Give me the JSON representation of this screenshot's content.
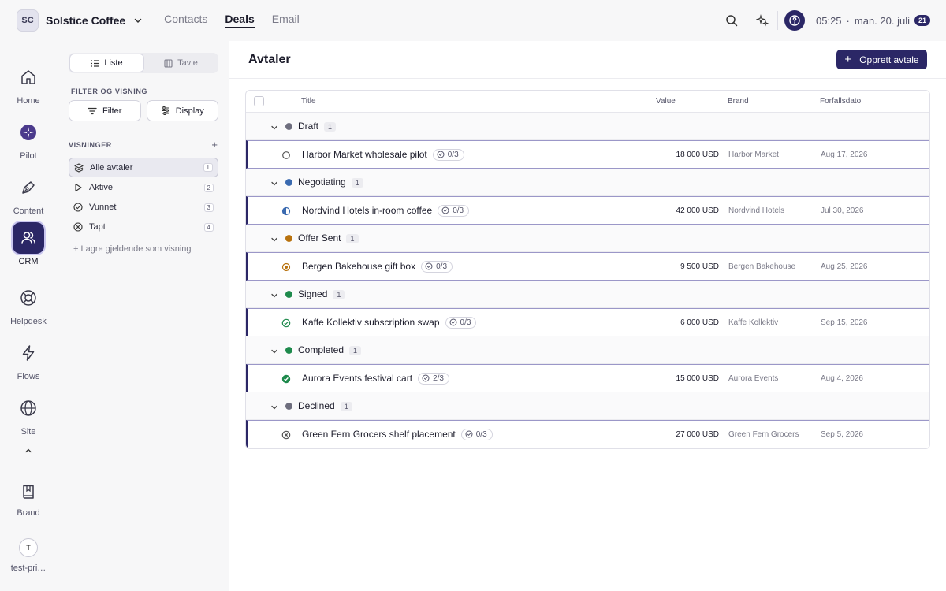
{
  "workspace": {
    "initials": "SC",
    "name": "Solstice Coffee"
  },
  "topnav": [
    {
      "label": "Contacts",
      "active": false
    },
    {
      "label": "Deals",
      "active": true
    },
    {
      "label": "Email",
      "active": false
    }
  ],
  "header": {
    "time": "05:25",
    "separator": "·",
    "date": "man. 20. juli",
    "day_badge": "21"
  },
  "rail": {
    "items": [
      {
        "label": "Home",
        "icon": "home-icon"
      },
      {
        "label": "Pilot",
        "icon": "pilot-icon"
      },
      {
        "label": "Content",
        "icon": "pen-icon"
      },
      {
        "label": "CRM",
        "icon": "users-icon",
        "active": true
      },
      {
        "label": "Helpdesk",
        "icon": "lifebuoy-icon"
      },
      {
        "label": "Flows",
        "icon": "lightning-icon"
      },
      {
        "label": "Site",
        "icon": "globe-icon"
      }
    ],
    "brand_label": "Brand",
    "user_initial": "T",
    "user_label": "test-pri…"
  },
  "sidebar": {
    "view_modes": [
      "Liste",
      "Tavle"
    ],
    "filter_section_title": "FILTER OG VISNING",
    "filter_label": "Filter",
    "display_label": "Display",
    "views_title": "VISNINGER",
    "views": [
      {
        "label": "Alle avtaler",
        "count": "1",
        "active": true
      },
      {
        "label": "Aktive",
        "count": "2"
      },
      {
        "label": "Vunnet",
        "count": "3"
      },
      {
        "label": "Tapt",
        "count": "4"
      }
    ],
    "save_view_label": "+ Lagre gjeldende som visning"
  },
  "main": {
    "title": "Avtaler",
    "create_label": "Opprett avtale",
    "columns": {
      "title": "Title",
      "value": "Value",
      "brand": "Brand",
      "due": "Forfallsdato"
    },
    "groups": [
      {
        "name": "Draft",
        "count": "1",
        "color": "#6e6e7e",
        "deal": {
          "title": "Harbor Market wholesale pilot",
          "tasks": "0/3",
          "value": "18 000 USD",
          "brand": "Harbor Market",
          "due": "Aug 17, 2026",
          "status_icon": "circle-empty-icon"
        }
      },
      {
        "name": "Negotiating",
        "count": "1",
        "color": "#3a6ab0",
        "deal": {
          "title": "Nordvind Hotels in-room coffee",
          "tasks": "0/3",
          "value": "42 000 USD",
          "brand": "Nordvind Hotels",
          "due": "Jul 30, 2026",
          "status_icon": "half-circle-icon"
        }
      },
      {
        "name": "Offer Sent",
        "count": "1",
        "color": "#b8720e",
        "deal": {
          "title": "Bergen Bakehouse gift box",
          "tasks": "0/3",
          "value": "9 500 USD",
          "brand": "Bergen Bakehouse",
          "due": "Aug 25, 2026",
          "status_icon": "target-icon"
        }
      },
      {
        "name": "Signed",
        "count": "1",
        "color": "#1e8a4c",
        "deal": {
          "title": "Kaffe Kollektiv subscription swap",
          "tasks": "0/3",
          "value": "6 000 USD",
          "brand": "Kaffe Kollektiv",
          "due": "Sep 15, 2026",
          "status_icon": "check-circle-icon"
        }
      },
      {
        "name": "Completed",
        "count": "1",
        "color": "#1e8a4c",
        "deal": {
          "title": "Aurora Events festival cart",
          "tasks": "2/3",
          "value": "15 000 USD",
          "brand": "Aurora Events",
          "due": "Aug 4, 2026",
          "status_icon": "check-filled-icon"
        }
      },
      {
        "name": "Declined",
        "count": "1",
        "color": "#6e6e7e",
        "deal": {
          "title": "Green Fern Grocers shelf placement",
          "tasks": "0/3",
          "value": "27 000 USD",
          "brand": "Green Fern Grocers",
          "due": "Sep 5, 2026",
          "status_icon": "x-circle-icon"
        }
      }
    ]
  },
  "colors": {
    "accent": "#2b2766",
    "row_border": "#9b97c8"
  }
}
